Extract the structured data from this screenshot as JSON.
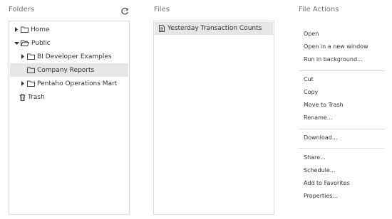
{
  "columns": {
    "folders": "Folders",
    "files": "Files",
    "actions": "File Actions"
  },
  "folder_tree": [
    {
      "label": "Home",
      "caret": "right",
      "icon": "folder-icon",
      "selected": false
    },
    {
      "label": "Public",
      "caret": "down",
      "icon": "folder-open-icon",
      "selected": false
    },
    {
      "label": "BI Developer Examples",
      "caret": "right",
      "icon": "folder-icon",
      "selected": false
    },
    {
      "label": "Company Reports",
      "caret": "none",
      "icon": "folder-icon",
      "selected": true
    },
    {
      "label": "Pentaho Operations Mart",
      "caret": "right",
      "icon": "folder-icon",
      "selected": false
    },
    {
      "label": "Trash",
      "caret": "none",
      "icon": "trash-icon",
      "selected": false
    }
  ],
  "files": [
    {
      "label": "Yesterday Transaction Counts",
      "icon": "report-file-icon",
      "selected": true
    }
  ],
  "actions": {
    "group1": [
      "Open",
      "Open in a new window",
      "Run in background..."
    ],
    "group2": [
      "Cut",
      "Copy",
      "Move to Trash",
      "Rename..."
    ],
    "group3": [
      "Download..."
    ],
    "group4": [
      "Share...",
      "Schedule...",
      "Add to Favorites",
      "Properties..."
    ]
  }
}
